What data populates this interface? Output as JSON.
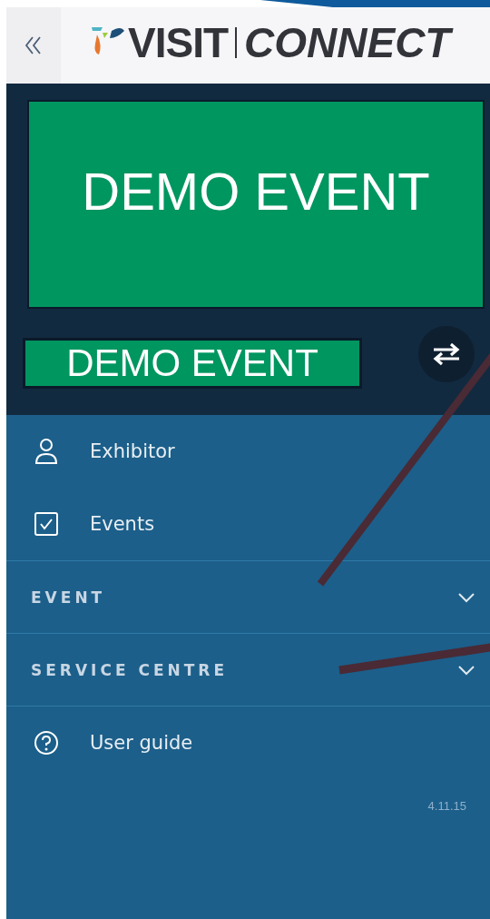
{
  "header": {
    "logo": {
      "word_1": "VISIT",
      "word_2": "CONNECT"
    }
  },
  "event_banner": {
    "title": "DEMO EVENT"
  },
  "event_name": "DEMO EVENT",
  "menu": [
    {
      "kind": "person",
      "label": "Exhibitor"
    },
    {
      "kind": "checkbox",
      "label": "Events"
    },
    {
      "kind": "section",
      "label": "EVENT",
      "expanded": false
    },
    {
      "kind": "section",
      "label": "SERVICE CENTRE",
      "expanded": false
    },
    {
      "kind": "help",
      "label": "User guide"
    }
  ],
  "version": "4.11.15"
}
